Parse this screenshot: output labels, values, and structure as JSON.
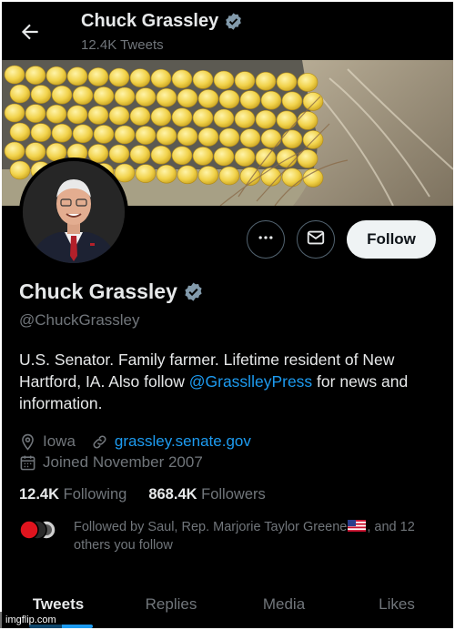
{
  "header": {
    "name": "Chuck Grassley",
    "tweet_count": "12.4K Tweets"
  },
  "profile": {
    "display_name": "Chuck Grassley",
    "handle": "@ChuckGrassley",
    "bio_before": "U.S. Senator. Family farmer. Lifetime resident of New Hartford, IA. Also follow ",
    "bio_mention": "@GrasslleyPress",
    "bio_after": " for news and information.",
    "location": "Iowa",
    "website": "grassley.senate.gov",
    "joined": "Joined November 2007"
  },
  "actions": {
    "follow_label": "Follow"
  },
  "stats": {
    "following_count": "12.4K",
    "following_label": "Following",
    "followers_count": "868.4K",
    "followers_label": "Followers"
  },
  "followed_by": {
    "text_before": "Followed by Saul, Rep. Marjorie Taylor Greene",
    "text_after": ", and 12 others you follow"
  },
  "tabs": [
    "Tweets",
    "Replies",
    "Media",
    "Likes"
  ],
  "watermark": "imgflip.com",
  "colors": {
    "background": "#000000",
    "accent": "#1d9bf0",
    "text_primary": "#e7e9ea",
    "text_secondary": "#71767b",
    "follow_button": "#eff3f4"
  },
  "icons": [
    "back-arrow-icon",
    "verified-badge-icon",
    "more-icon",
    "message-icon",
    "location-icon",
    "link-icon",
    "calendar-icon",
    "us-flag-icon"
  ]
}
